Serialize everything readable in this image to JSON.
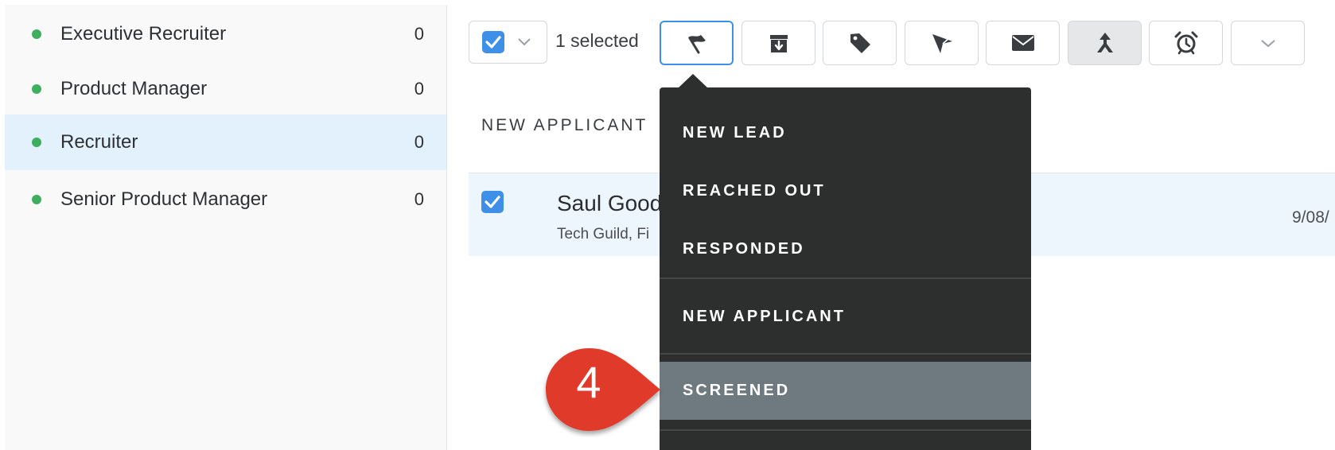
{
  "sidebar": {
    "items": [
      {
        "label": "Executive Recruiter",
        "count": "0",
        "active": false
      },
      {
        "label": "Product Manager",
        "count": "0",
        "active": false
      },
      {
        "label": "Recruiter",
        "count": "0",
        "active": true
      },
      {
        "label": "Senior Product Manager",
        "count": "0",
        "active": false
      }
    ],
    "dot_color": "#3fae5f"
  },
  "toolbar": {
    "selected_text": "1 selected",
    "buttons": [
      {
        "icon": "flag-icon",
        "state": "focused"
      },
      {
        "icon": "archive-icon",
        "state": "normal"
      },
      {
        "icon": "tag-icon",
        "state": "normal"
      },
      {
        "icon": "send-icon",
        "state": "normal"
      },
      {
        "icon": "mail-icon",
        "state": "normal"
      },
      {
        "icon": "merge-icon",
        "state": "pressed"
      },
      {
        "icon": "alarm-clock-icon",
        "state": "normal"
      },
      {
        "icon": "chevron-down-icon",
        "state": "normal"
      }
    ]
  },
  "content": {
    "stage_header": "NEW APPLICANT",
    "row": {
      "name": "Saul Good",
      "company": "Tech Guild, Fi",
      "date": "9/08/",
      "checked": true
    }
  },
  "menu": {
    "items": [
      "NEW LEAD",
      "REACHED OUT",
      "RESPONDED",
      "NEW APPLICANT",
      "SCREENED"
    ],
    "highlighted": "SCREENED"
  },
  "callout": {
    "number": "4",
    "color": "#e03a2a"
  },
  "colors": {
    "accent": "#3d8fe8",
    "menu_bg": "#2d2f2f",
    "menu_highlight": "#6e7a80",
    "row_bg": "#eef6fd"
  }
}
